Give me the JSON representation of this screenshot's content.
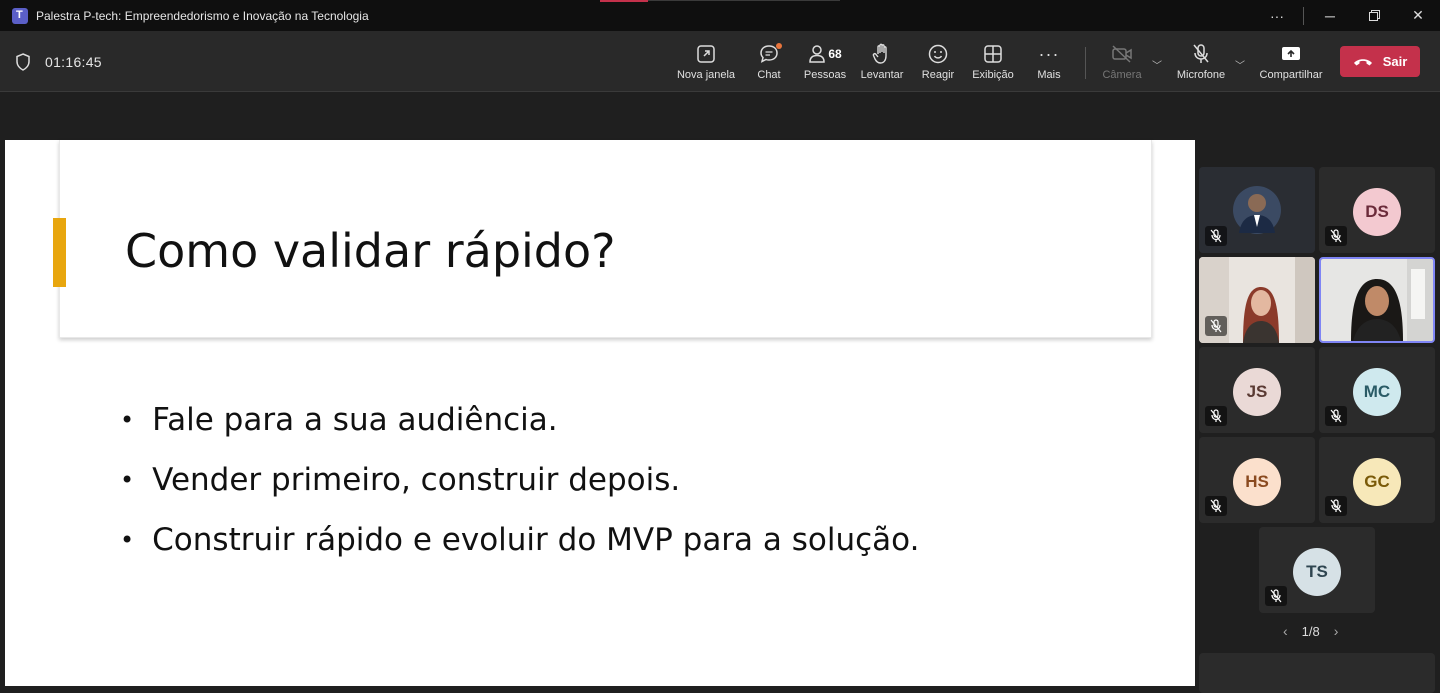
{
  "window": {
    "title": "Palestra P-tech: Empreendedorismo e Inovação na Tecnologia",
    "controls": [
      "more-icon",
      "minimize-icon",
      "restore-icon",
      "close-icon"
    ]
  },
  "meeting": {
    "timer": "01:16:45",
    "toolbar": {
      "new_window": "Nova janela",
      "chat": "Chat",
      "people": "Pessoas",
      "people_count": "68",
      "raise": "Levantar",
      "react": "Reagir",
      "view": "Exibição",
      "more": "Mais",
      "camera": "Câmera",
      "mic": "Microfone",
      "share": "Compartilhar",
      "leave": "Sair"
    }
  },
  "slide": {
    "title": "Como validar rápido?",
    "bullets": [
      "Fale para a sua audiência.",
      "Vender primeiro, construir depois.",
      "Construir rápido e evoluir do MVP para a solução."
    ]
  },
  "participants": [
    {
      "initials": "",
      "type": "photo"
    },
    {
      "initials": "DS",
      "type": "initials",
      "bg": "#f3c9d0",
      "fg": "#6b2b3a"
    },
    {
      "initials": "",
      "type": "photo"
    },
    {
      "initials": "",
      "type": "photo",
      "selected": true
    },
    {
      "initials": "JS",
      "type": "initials",
      "bg": "#ead9d6",
      "fg": "#5a3a33"
    },
    {
      "initials": "MC",
      "type": "initials",
      "bg": "#cfe9ee",
      "fg": "#2a5b66"
    },
    {
      "initials": "HS",
      "type": "initials",
      "bg": "#fbe0cc",
      "fg": "#8a4a1f"
    },
    {
      "initials": "GC",
      "type": "initials",
      "bg": "#f7e8b9",
      "fg": "#7a5a08"
    },
    {
      "initials": "TS",
      "type": "initials",
      "bg": "#d6e1e6",
      "fg": "#2f4550"
    }
  ],
  "pager": {
    "label": "1/8"
  },
  "colors": {
    "accent": "#e8a60e",
    "leave": "#c4314b",
    "selected_border": "#7f85f5"
  }
}
